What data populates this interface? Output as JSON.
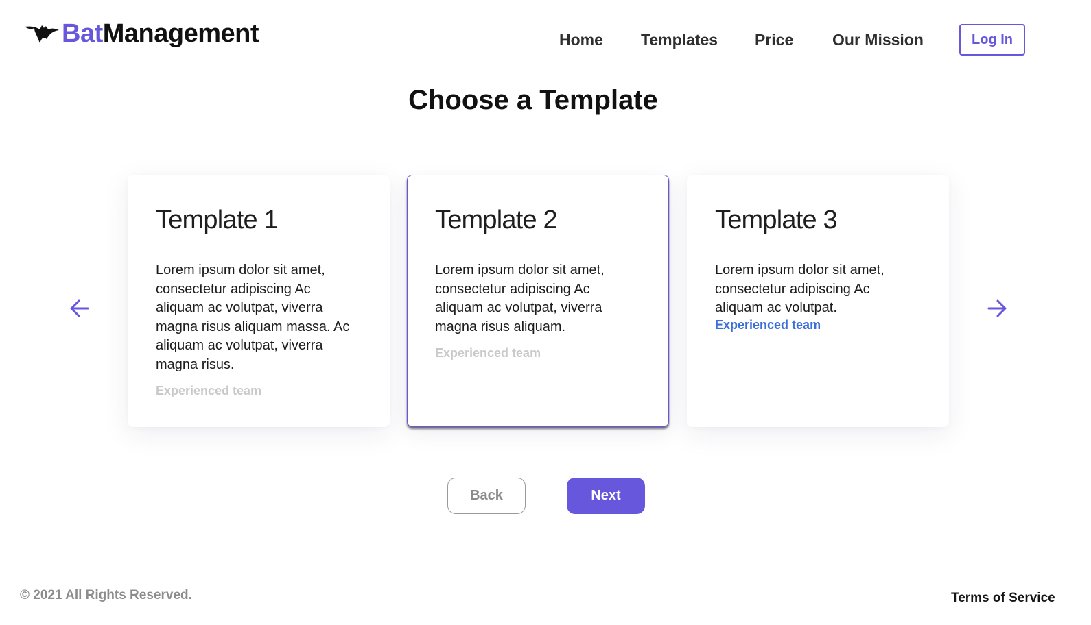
{
  "brand": {
    "name_part_1": "Bat",
    "name_part_2": "Management",
    "logo_icon": "bat-icon",
    "accent_color": "#6657dc"
  },
  "nav": {
    "items": [
      {
        "label": "Home"
      },
      {
        "label": "Templates"
      },
      {
        "label": "Price"
      },
      {
        "label": "Our Mission"
      }
    ],
    "login_label": "Log In"
  },
  "main": {
    "title": "Choose a Template",
    "selected_card": 2,
    "cards": [
      {
        "title": "Template 1",
        "body": "Lorem ipsum dolor sit amet, consectetur adipiscing Ac aliquam ac volutpat, viverra magna risus aliquam massa. Ac aliquam ac volutpat, viverra magna risus.",
        "tag": "Experienced team"
      },
      {
        "title": "Template 2",
        "body": "Lorem ipsum dolor sit amet, consectetur adipiscing Ac aliquam ac volutpat, viverra magna risus aliquam.",
        "tag": "Experienced team"
      },
      {
        "title": "Template 3",
        "body": "Lorem ipsum dolor sit amet, consectetur adipiscing Ac aliquam ac volutpat.",
        "tag": "Experienced team"
      }
    ],
    "prev_icon": "arrow-left-icon",
    "next_icon": "arrow-right-icon",
    "back_label": "Back",
    "next_label": "Next"
  },
  "footer": {
    "copyright": "© 2021 All Rights Reserved.",
    "terms": "Terms of Service"
  }
}
